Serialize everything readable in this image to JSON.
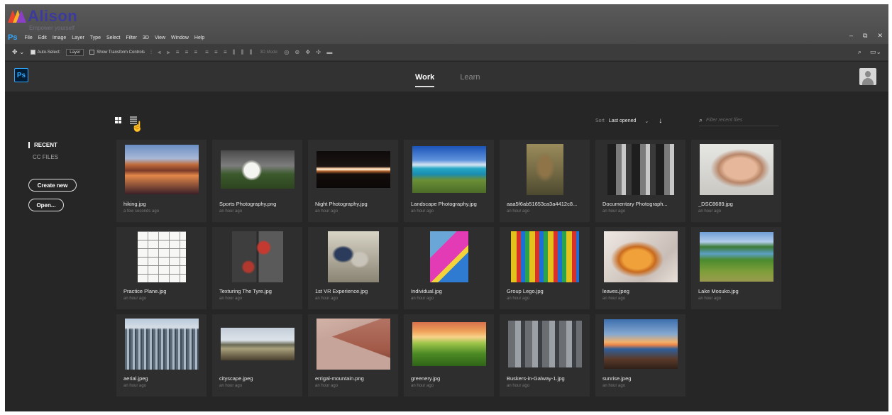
{
  "branding": {
    "name": "Alison",
    "tagline": "Empower yourself"
  },
  "menubar": {
    "app_badge": "Ps",
    "items": [
      "File",
      "Edit",
      "Image",
      "Layer",
      "Type",
      "Select",
      "Filter",
      "3D",
      "View",
      "Window",
      "Help"
    ],
    "window_controls": [
      "–",
      "⧉",
      "✕"
    ]
  },
  "options_bar": {
    "move_tool": "✥ ⌄",
    "auto_select_label": "Auto-Select:",
    "auto_select_value": "Layer",
    "show_transform_label": "Show Transform Controls",
    "mode_3d_label": "3D Mode:",
    "align_glyphs": "⫶ ⫷ ⫸ ≡ ≡ ≡",
    "distribute_glyphs": "≡ ≡ ≡ ⫼ ⫼ ⫼",
    "threed_glyphs": "◎ ⊛ ✥ ✣ ▬"
  },
  "header": {
    "logo": "Ps",
    "tabs": [
      {
        "label": "Work",
        "active": true
      },
      {
        "label": "Learn",
        "active": false
      }
    ]
  },
  "sidebar": {
    "items": [
      {
        "label": "RECENT",
        "active": true
      },
      {
        "label": "CC FILES",
        "active": false
      }
    ],
    "create_new": "Create new",
    "open": "Open..."
  },
  "toolbar": {
    "sort_label": "Sort",
    "sort_value": "Last opened",
    "filter_placeholder": "Filter recent files"
  },
  "files": [
    {
      "name": "hiking.jpg",
      "time": "a few seconds ago",
      "icon": "mountain-lake-thumb"
    },
    {
      "name": "Sports Photography.png",
      "time": "an hour ago",
      "icon": "volleyball-thumb"
    },
    {
      "name": "Night Photography.jpg",
      "time": "an hour ago",
      "icon": "light-trail-thumb"
    },
    {
      "name": "Landscape Photography.jpg",
      "time": "an hour ago",
      "icon": "coast-thumb"
    },
    {
      "name": "aaa5f6ab51653ca3a4412c8...",
      "time": "an hour ago",
      "icon": "meerkat-thumb"
    },
    {
      "name": "Documentary Photograph...",
      "time": "an hour ago",
      "icon": "bw-group-thumb"
    },
    {
      "name": "_DSC8689.jpg",
      "time": "an hour ago",
      "icon": "portrait-thumb"
    },
    {
      "name": "Practice Plane.jpg",
      "time": "an hour ago",
      "icon": "plane-sketch-thumb"
    },
    {
      "name": "Texturing The Tyre.jpg",
      "time": "an hour ago",
      "icon": "3d-viewport-thumb"
    },
    {
      "name": "1st VR Experience.jpg",
      "time": "an hour ago",
      "icon": "vr-thumb"
    },
    {
      "name": "Individual.jpg",
      "time": "an hour ago",
      "icon": "lego-brick-thumb"
    },
    {
      "name": "Group Lego.jpg",
      "time": "an hour ago",
      "icon": "lego-group-thumb"
    },
    {
      "name": "leaves.jpeg",
      "time": "an hour ago",
      "icon": "leaves-thumb"
    },
    {
      "name": "Lake Mosuko.jpg",
      "time": "an hour ago",
      "icon": "lake-thumb"
    },
    {
      "name": "aerial.jpeg",
      "time": "an hour ago",
      "icon": "aerial-city-thumb"
    },
    {
      "name": "cityscape.jpeg",
      "time": "an hour ago",
      "icon": "cityscape-thumb"
    },
    {
      "name": "errigal-mountain.png",
      "time": "an hour ago",
      "icon": "red-mountain-thumb"
    },
    {
      "name": "greenery.jpg",
      "time": "an hour ago",
      "icon": "greenery-thumb"
    },
    {
      "name": "Buskers-in-Galway-1.jpg",
      "time": "an hour ago",
      "icon": "buskers-thumb"
    },
    {
      "name": "sunrise.jpeg",
      "time": "an hour ago",
      "icon": "pier-sunrise-thumb"
    }
  ]
}
